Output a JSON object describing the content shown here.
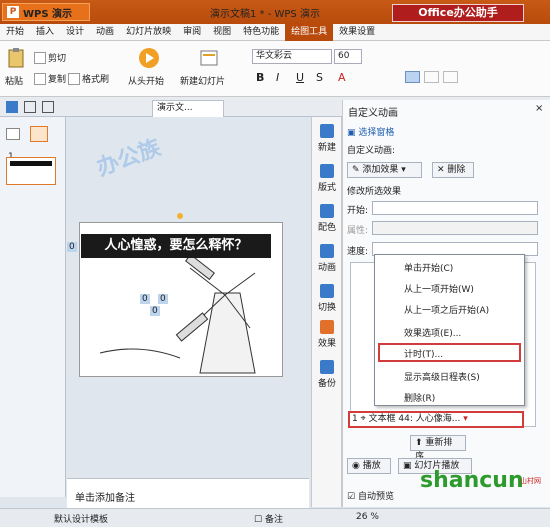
{
  "titlebar": {
    "app_label": "WPS 演示",
    "doc_title": "演示文稿1 * - WPS 演示",
    "brand_label": "Office办公助手"
  },
  "menu": [
    "开始",
    "插入",
    "设计",
    "动画",
    "幻灯片放映",
    "审阅",
    "视图",
    "特色功能",
    "绘图工具",
    "效果设置"
  ],
  "menu_active": "绘图工具",
  "ribbon": {
    "paste": "粘贴",
    "cut": "剪切",
    "copy": "复制",
    "format_painter": "格式刷",
    "from_start": "从头开始",
    "new_slide": "新建幻灯片",
    "font_name": "华文彩云",
    "font_size": "60"
  },
  "tabs": {
    "doc_tab": "演示文..."
  },
  "thumbnails": {
    "slide_number": "1"
  },
  "slide": {
    "banner_text": "人心惶惑，要怎么释怀？",
    "marker_a": "0",
    "marker_b": "0",
    "marker_c": "0",
    "marker_d": "0"
  },
  "notes": {
    "placeholder": "单击添加备注"
  },
  "tools": [
    "新建",
    "版式",
    "配色",
    "动画",
    "切换",
    "效果",
    "备份"
  ],
  "panel": {
    "title": "自定义动画",
    "select_pane": "选择窗格",
    "custom_label": "自定义动画:",
    "add_effect": "添加效果",
    "delete": "删除",
    "modify_label": "修改所选效果",
    "start_label": "开始:",
    "property_label": "属性:",
    "speed_label": "速度:",
    "reorder": "重新排序",
    "play": "播放",
    "slideshow": "幻灯片播放",
    "autopreview": "自动预览"
  },
  "anim_item": {
    "index": "1",
    "text": "文本框 44: 人心像海..."
  },
  "context_menu": [
    "单击开始(C)",
    "从上一项开始(W)",
    "从上一项之后开始(A)",
    "效果选项(E)...",
    "计时(T)...",
    "显示高级日程表(S)",
    "删除(R)"
  ],
  "status": {
    "template": "默认设计模板",
    "notes": "备注",
    "zoom": "26 %"
  },
  "watermark": {
    "site": "shancun",
    "site_sub": "山村网",
    "logo": "办公族"
  }
}
